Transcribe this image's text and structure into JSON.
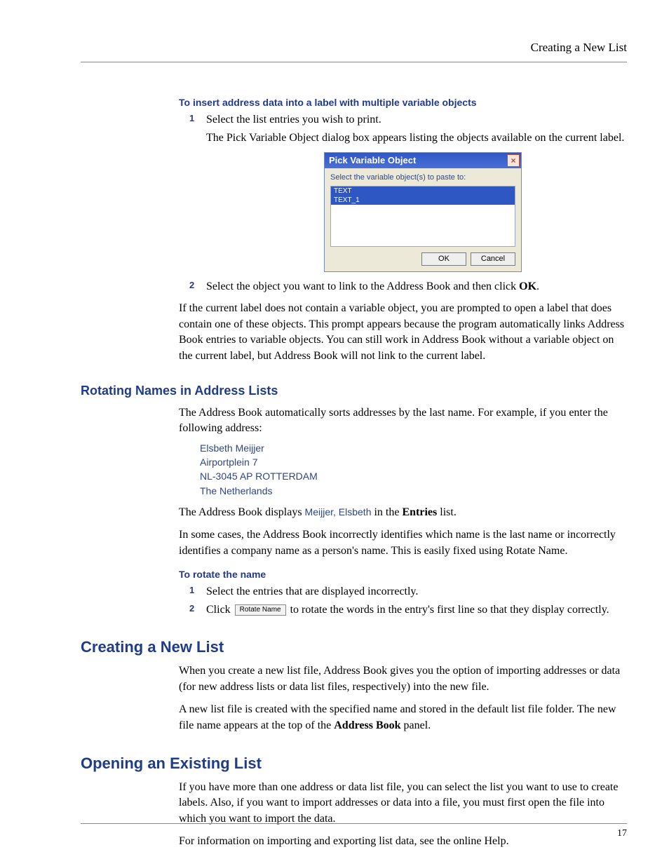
{
  "header": {
    "section_title": "Creating a New List"
  },
  "task1": {
    "heading": "To insert address data into a label with multiple variable objects",
    "step1": "Select the list entries you wish to print.",
    "step1_sub": "The Pick Variable Object dialog box appears listing the objects available on the current label.",
    "step2_prefix": "Select the object you want to link to the Address Book and then click ",
    "step2_bold": "OK",
    "step2_suffix": "."
  },
  "dialog": {
    "title": "Pick Variable Object",
    "prompt": "Select the variable object(s) to paste to:",
    "items": [
      "TEXT",
      "TEXT_1"
    ],
    "ok": "OK",
    "cancel": "Cancel"
  },
  "para_novarobj": "If the current label does not contain a variable object, you are prompted to open a label that does contain one of these objects. This prompt appears because the program automatically links Address Book entries to variable objects. You can still work in Address Book without a variable object on the current label, but Address Book will not link to the current label.",
  "rotating": {
    "heading": "Rotating Names in Address Lists",
    "intro": "The Address Book automatically sorts addresses by the last name. For example, if you enter the following address:",
    "address": {
      "line1": "Elsbeth Meijjer",
      "line2": "Airportplein 7",
      "line3": "NL-3045 AP ROTTERDAM",
      "line4": "The Netherlands"
    },
    "display_prefix": "The Address Book displays ",
    "display_name": "Meijjer, Elsbeth",
    "display_mid": " in the ",
    "display_bold": "Entries",
    "display_suffix": " list.",
    "note": "In some cases, the Address Book incorrectly identifies which name is the last name or incorrectly identifies a company name as a person's name. This is easily fixed using Rotate Name.",
    "subtask": "To rotate the name",
    "step1": "Select the entries that are displayed incorrectly.",
    "step2_prefix": "Click ",
    "rotate_btn_label": "Rotate Name",
    "step2_suffix": " to rotate the words in the entry's first line so that they display correctly."
  },
  "creating": {
    "heading": "Creating a New List",
    "p1": "When you create a new list file, Address Book gives you the option of importing addresses or data (for new address lists or data list files, respectively) into the new file.",
    "p2_prefix": "A new list file is created with the specified name and stored in the default list file folder. The new file name appears at the top of the ",
    "p2_bold": "Address Book",
    "p2_suffix": " panel."
  },
  "opening": {
    "heading": "Opening an Existing List",
    "p1": "If you have more than one address or data list file, you can select the list you want to use to create labels. Also, if you want to import addresses or data into a file, you must first open the file into which you want to import the data.",
    "p2": "For information on importing and exporting list data, see the online Help."
  },
  "page_number": "17"
}
